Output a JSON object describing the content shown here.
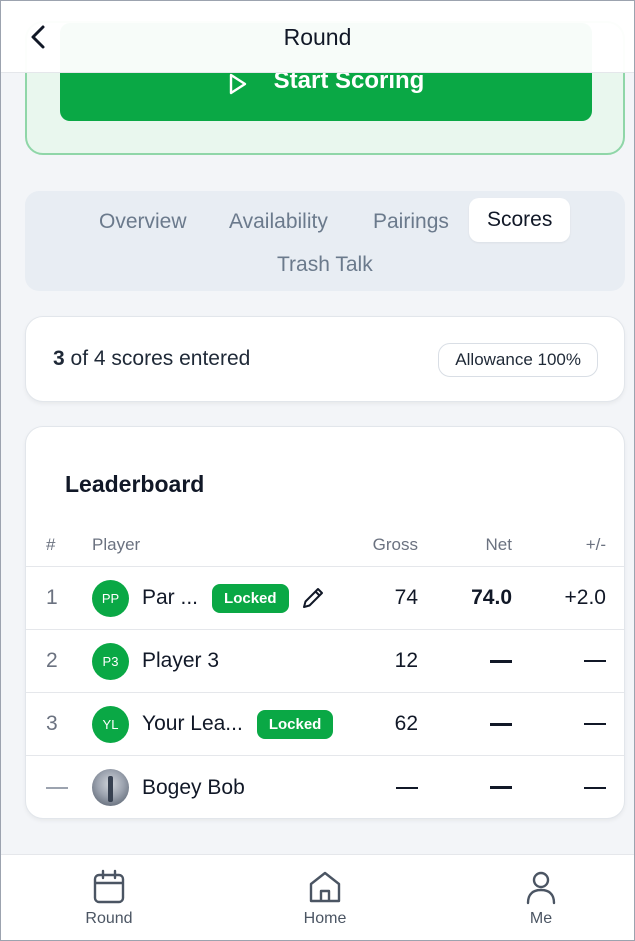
{
  "header": {
    "title": "Round",
    "back_icon": "chevron-left-icon"
  },
  "cta": {
    "label": "Start Scoring",
    "icon": "play-icon",
    "color": "#0aa845"
  },
  "tabs": [
    {
      "label": "Overview",
      "active": false
    },
    {
      "label": "Availability",
      "active": false
    },
    {
      "label": "Pairings",
      "active": false
    },
    {
      "label": "Scores",
      "active": true
    },
    {
      "label": "Trash Talk",
      "active": false
    }
  ],
  "summary": {
    "entered": "3",
    "text": "of 4 scores entered",
    "allowance": "Allowance 100%"
  },
  "leaderboard": {
    "title": "Leaderboard",
    "columns": {
      "rank": "#",
      "player": "Player",
      "gross": "Gross",
      "net": "Net",
      "diff": "+/-"
    },
    "rows": [
      {
        "rank": "1",
        "initials": "PP",
        "name": "Par ...",
        "badge": "Locked",
        "gross": "74",
        "net": "74.0",
        "diff": "+2.0"
      },
      {
        "rank": "2",
        "initials": "P3",
        "name": "Player 3",
        "gross": "12"
      },
      {
        "rank": "3",
        "initials": "YL",
        "name": "Your Lea...",
        "badge": "Locked",
        "gross": "62"
      },
      {
        "name": "Bogey Bob"
      }
    ]
  },
  "nav": {
    "round": "Round",
    "home": "Home",
    "me": "Me"
  }
}
